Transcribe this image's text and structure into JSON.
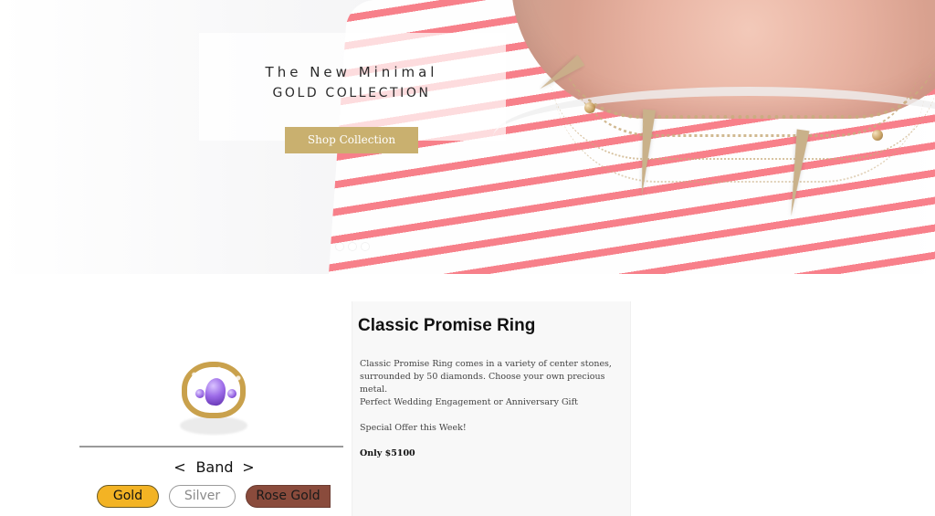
{
  "hero": {
    "title_line_1": "The New Minimal",
    "title_line_2": "GOLD COLLECTION",
    "cta_label": "Shop Collection",
    "carousel": {
      "count": 3,
      "active_index": 1
    },
    "colors": {
      "accent_button": "#c9b06f",
      "stripe_pink": "#f37b86"
    }
  },
  "product": {
    "configurator": {
      "category_label": "Band",
      "prev_label": "<",
      "next_label": ">",
      "metal_options": [
        {
          "label": "Gold",
          "selected": true,
          "color": "#f3b324"
        },
        {
          "label": "Silver",
          "selected": false,
          "color": "#ffffff"
        },
        {
          "label": "Rose Gold",
          "selected": false,
          "color": "#8a4b3c"
        }
      ]
    },
    "details": {
      "title": "Classic Promise Ring",
      "desc_1": "Classic Promise Ring comes in a variety of center stones, surrounded by 50 diamonds. Choose your own precious metal.",
      "desc_2": "Perfect Wedding Engagement or Anniversary Gift",
      "desc_3": "Special Offer this Week!",
      "price_text": "Only $5100"
    },
    "icons": {
      "ring_image": "ring-image-icon",
      "prev": "chevron-left-icon",
      "next": "chevron-right-icon"
    }
  }
}
